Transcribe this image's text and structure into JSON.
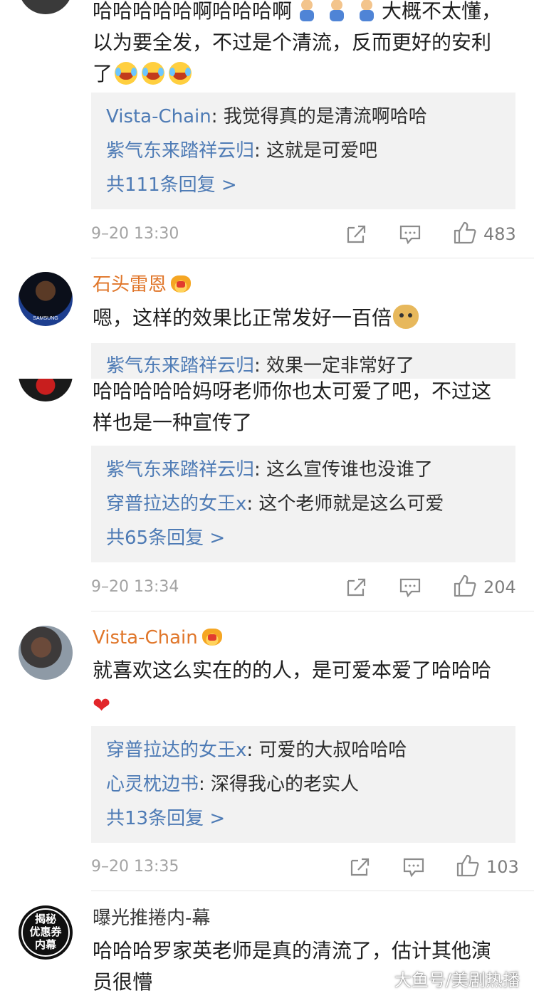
{
  "comments": [
    {
      "text_parts": [
        "哈哈哈哈哈啊哈哈哈啊",
        "大概不太懂，以为要全发，不过是个清流，反而更好的安利了"
      ],
      "replies": [
        {
          "user": "Vista-Chain",
          "text": ": 我觉得真的是清流啊哈哈"
        },
        {
          "user": "紫气东来踏祥云归",
          "text": ": 这就是可爱吧"
        }
      ],
      "more": "共111条回复 >",
      "time": "9–20 13:30",
      "likes": "483"
    },
    {
      "user": "石头雷恩",
      "text": "嗯，这样的效果比正常发好一百倍",
      "replies": [
        {
          "user": "紫气东来踏祥云归",
          "text": ": 效果一定非常好了"
        }
      ]
    },
    {
      "text": "哈哈哈哈哈妈呀老师你也太可爱了吧，不过这样也是一种宣传了",
      "replies": [
        {
          "user": "紫气东来踏祥云归",
          "text": ": 这么宣传谁也没谁了"
        },
        {
          "user": "穿普拉达的女王x",
          "text": ": 这个老师就是这么可爱"
        }
      ],
      "more": "共65条回复 >",
      "time": "9–20 13:34",
      "likes": "204"
    },
    {
      "user": "Vista-Chain",
      "text": "就喜欢这么实在的的人，是可爱本爱了哈哈哈",
      "replies": [
        {
          "user": "穿普拉达的女王x",
          "text": ": 可爱的大叔哈哈哈"
        },
        {
          "user": "心灵枕边书",
          "text": ": 深得我心的老实人"
        }
      ],
      "more": "共13条回复 >",
      "time": "9–20 13:35",
      "likes": "103"
    },
    {
      "user": "曝光推捲内-幕",
      "avatar_text": [
        "揭秘",
        "优惠券",
        "内幕"
      ],
      "text": "哈哈哈罗家英老师是真的清流了，估计其他演员很懵"
    }
  ],
  "avatar_jersey_text": "SAMSUNG",
  "watermark": "大鱼号/美剧热播",
  "icons": [
    "share-icon",
    "comment-icon",
    "like-icon",
    "crown-badge-icon",
    "cry-laugh-emoji",
    "kid-emoji",
    "doge-emoji",
    "heart-emoji"
  ],
  "colors": {
    "username": "#e0762a",
    "reply_user": "#4e7bb5",
    "reply_bg": "#f2f2f2",
    "meta": "#a3a3a3"
  }
}
